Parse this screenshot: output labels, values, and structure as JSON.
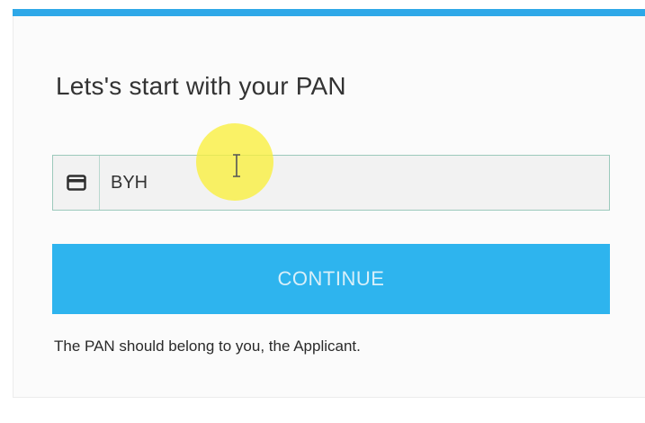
{
  "form": {
    "heading": "Lets's start with your PAN",
    "pan_input": {
      "value": "BYH",
      "icon": "card-icon"
    },
    "continue_label": "CONTINUE",
    "helper_text": "The PAN should belong to you, the Applicant."
  },
  "colors": {
    "accent": "#2ea8e8",
    "button": "#2eb4ee",
    "cursor_highlight": "#faf03c"
  }
}
